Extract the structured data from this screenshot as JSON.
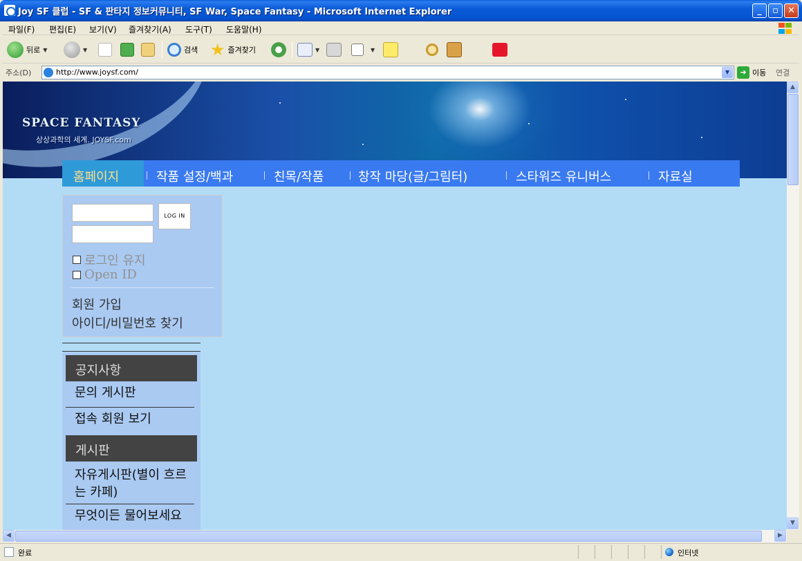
{
  "window": {
    "title": "Joy SF 클럽 - SF & 판타지 정보커뮤니티, SF War, Space Fantasy - Microsoft Internet Explorer"
  },
  "menubar": {
    "items": [
      "파일(F)",
      "편집(E)",
      "보기(V)",
      "즐겨찾기(A)",
      "도구(T)",
      "도움말(H)"
    ]
  },
  "toolbar": {
    "back_label": "뒤로",
    "search_label": "검색",
    "favorites_label": "즐겨찾기"
  },
  "address": {
    "label": "주소(D)",
    "url": "http://www.joysf.com/",
    "go_label": "이동",
    "links_label": "연결"
  },
  "site": {
    "logo_text": "SPACE FANTASY",
    "logo_sub": "상상과학의 세계. JOYSF.com",
    "nav": [
      "홈페이지",
      "작품 설정/백과",
      "친목/작품",
      "창작 마당(글/그림터)",
      "스타워즈 유니버스",
      "자료실"
    ],
    "login": {
      "button": "LOG IN",
      "keep_login": "로그인 유지",
      "open_id": "Open ID",
      "signup": "회원 가입",
      "find": "아이디/비밀번호 찾기"
    },
    "menu": {
      "head1": "공지사항",
      "link1": "문의 게시판",
      "link2": "접속 회원 보기",
      "head2": "게시판",
      "link3": "자유게시판(별이 흐르는 카페)",
      "link4": "무엇이든 물어보세요"
    }
  },
  "status": {
    "text": "완료",
    "zone": "인터넷"
  }
}
